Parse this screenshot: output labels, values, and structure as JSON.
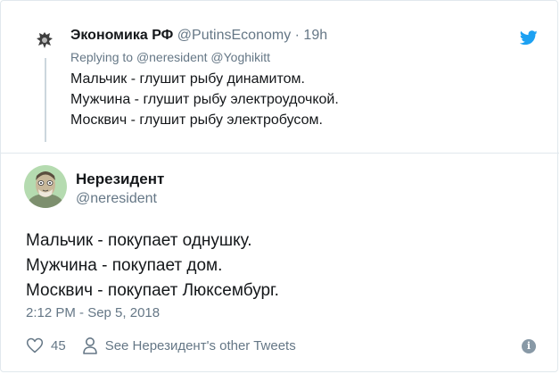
{
  "parent_tweet": {
    "name": "Экономика РФ",
    "handle": "@PutinsEconomy",
    "dot": "·",
    "time": "19h",
    "reply_prefix": "Replying to",
    "reply_mentions": "@neresident @Yoghikitt",
    "lines": [
      "Мальчик - глушит рыбу динамитом.",
      "Мужчина - глушит рыбу электроудочкой.",
      "Москвич - глушит рыбу электробусом."
    ]
  },
  "main_tweet": {
    "name": "Нерезидент",
    "handle": "@neresident",
    "lines": [
      "Мальчик - покупает однушку.",
      "Мужчина - покупает дом.",
      "Москвич - покупает Люксембург."
    ],
    "timestamp": "2:12 PM - Sep 5, 2018",
    "likes": "45",
    "see_other_label": "See Нерезидент's other Tweets"
  },
  "icons": {
    "brand": "twitter-bird-icon",
    "like": "heart-icon",
    "profile": "person-icon",
    "info": "info-icon",
    "info_glyph": "i"
  },
  "colors": {
    "twitter_blue": "#1da1f2",
    "secondary_text": "#657786",
    "thread_line": "#ccd6dd"
  }
}
